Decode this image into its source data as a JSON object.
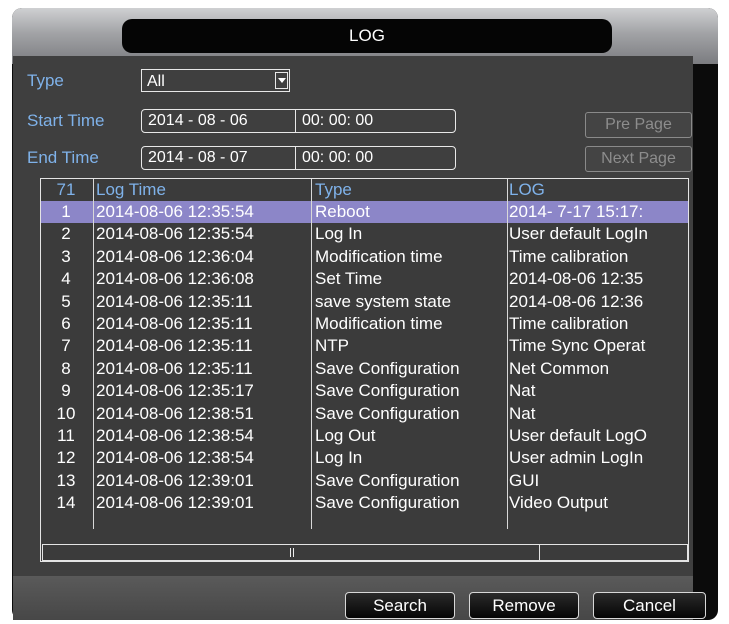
{
  "window": {
    "title": "LOG"
  },
  "filters": {
    "type_label": "Type",
    "type_value": "All",
    "start_label": "Start Time",
    "start_date": "2014 - 08 - 06",
    "start_time": "00: 00: 00",
    "end_label": "End Time",
    "end_date": "2014 - 08 - 07",
    "end_time": "00: 00: 00"
  },
  "paging": {
    "prev_label": "Pre Page",
    "next_label": "Next Page"
  },
  "table": {
    "headers": {
      "count": "71",
      "log_time": "Log Time",
      "type": "Type",
      "log": "LOG"
    },
    "rows": [
      {
        "n": "1",
        "time": "2014-08-06 12:35:54",
        "type": "Reboot",
        "log": "2014- 7-17 15:17:"
      },
      {
        "n": "2",
        "time": "2014-08-06 12:35:54",
        "type": "Log In",
        "log": "User default LogIn"
      },
      {
        "n": "3",
        "time": "2014-08-06 12:36:04",
        "type": "Modification time",
        "log": "Time calibration"
      },
      {
        "n": "4",
        "time": "2014-08-06 12:36:08",
        "type": "Set Time",
        "log": "2014-08-06 12:35"
      },
      {
        "n": "5",
        "time": "2014-08-06 12:35:11",
        "type": "save system state",
        "log": "2014-08-06 12:36"
      },
      {
        "n": "6",
        "time": "2014-08-06 12:35:11",
        "type": "Modification time",
        "log": "Time calibration"
      },
      {
        "n": "7",
        "time": "2014-08-06 12:35:11",
        "type": "NTP",
        "log": "Time Sync Operat"
      },
      {
        "n": "8",
        "time": "2014-08-06 12:35:11",
        "type": "Save Configuration",
        "log": "Net Common"
      },
      {
        "n": "9",
        "time": "2014-08-06 12:35:17",
        "type": "Save Configuration",
        "log": "Nat"
      },
      {
        "n": "10",
        "time": "2014-08-06 12:38:51",
        "type": "Save Configuration",
        "log": "Nat"
      },
      {
        "n": "11",
        "time": "2014-08-06 12:38:54",
        "type": "Log Out",
        "log": "User default LogO"
      },
      {
        "n": "12",
        "time": "2014-08-06 12:38:54",
        "type": "Log In",
        "log": "User admin LogIn"
      },
      {
        "n": "13",
        "time": "2014-08-06 12:39:01",
        "type": "Save Configuration",
        "log": "GUI"
      },
      {
        "n": "14",
        "time": "2014-08-06 12:39:01",
        "type": "Save Configuration",
        "log": "Video Output"
      }
    ],
    "selected_row": "1"
  },
  "actions": {
    "search_label": "Search",
    "remove_label": "Remove",
    "cancel_label": "Cancel"
  },
  "icons": {
    "type_dropdown": "chevron-down-icon",
    "scroll_grip": "grip-icon"
  },
  "colors": {
    "label_blue": "#7fb2ea",
    "selection": "#8c86c8",
    "panel": "#3f3f3f"
  }
}
